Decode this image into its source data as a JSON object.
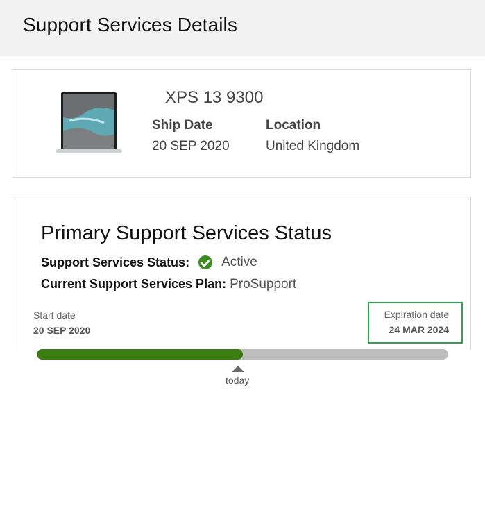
{
  "header": {
    "title": "Support Services Details"
  },
  "device": {
    "model": "XPS 13 9300",
    "ship_date_label": "Ship Date",
    "ship_date": "20 SEP 2020",
    "location_label": "Location",
    "location": "United Kingdom",
    "image_icon": "laptop-icon"
  },
  "status": {
    "title": "Primary Support Services Status",
    "status_label": "Support Services Status:",
    "status_value": "Active",
    "status_icon": "check-circle-icon",
    "status_color": "#3a8a1f",
    "plan_label": "Current Support Services Plan:",
    "plan_value": "ProSupport",
    "start_label": "Start date",
    "start_date": "20 SEP 2020",
    "expiration_label": "Expiration date",
    "expiration_date": "24 MAR 2024",
    "highlight_color": "#2fa34a"
  },
  "timeline": {
    "progress_fraction": 0.5,
    "progress_color": "#3a7d12",
    "track_color": "#bdbdbd",
    "today_label": "today"
  }
}
